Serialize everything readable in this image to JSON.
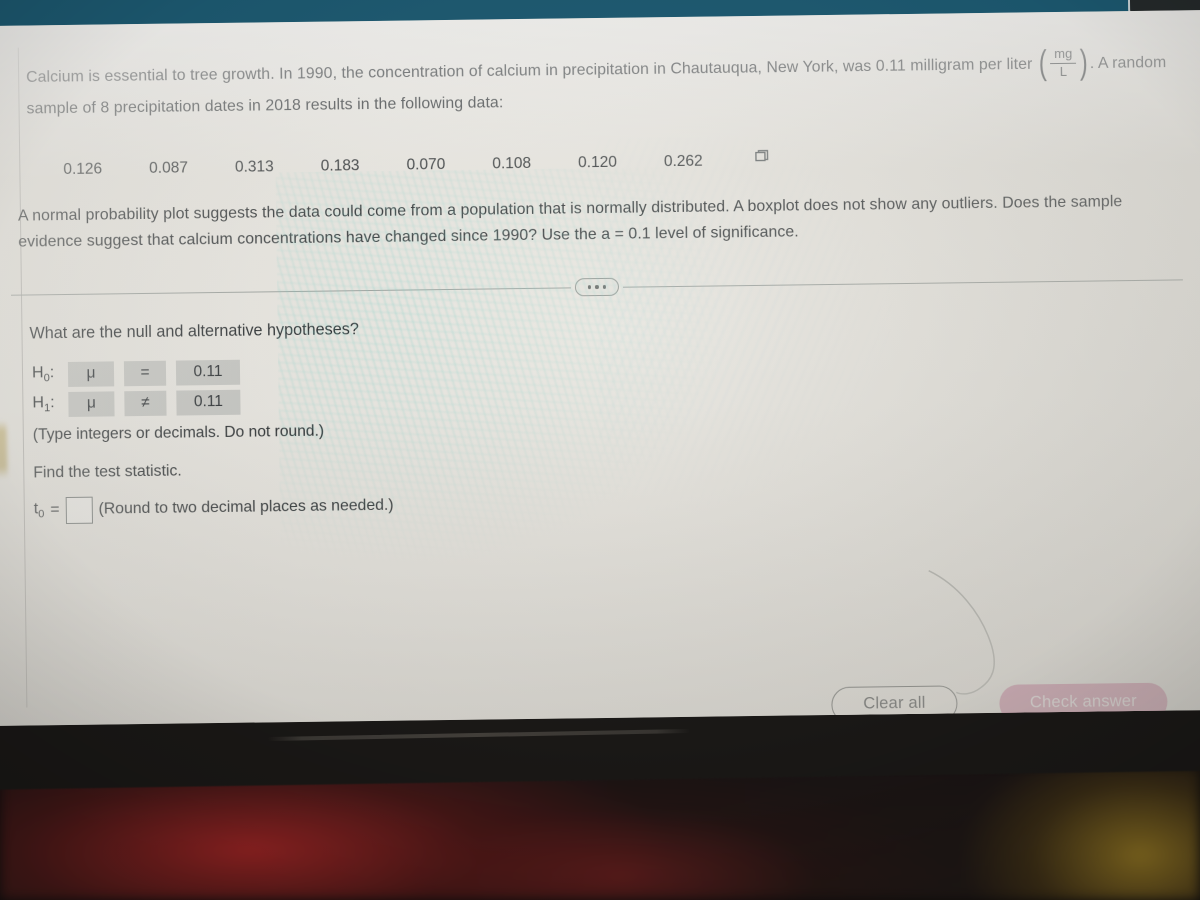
{
  "window": {
    "chrome_color": "#1d5b73",
    "page_background": "#eceae4"
  },
  "exercise": {
    "intro_part1": "Calcium is essential to tree growth. In 1990, the concentration of calcium in precipitation in Chautauqua, New York, was 0.11 milligram per liter",
    "unit_numerator": "mg",
    "unit_denominator": "L",
    "intro_part2": ". A random sample of 8 precipitation dates in 2018 results in the following data:",
    "data_values": [
      "0.126",
      "0.087",
      "0.313",
      "0.183",
      "0.070",
      "0.108",
      "0.120",
      "0.262"
    ],
    "copy_icon": "copy-to-spreadsheet-icon",
    "normal_plot_text": "A normal probability plot suggests the data could come from a population that is normally distributed. A boxplot does not show any outliers. Does the sample evidence suggest that calcium concentrations have changed since 1990? Use the a = 0.1 level of significance.",
    "expander_icon": "ellipsis-expander-icon"
  },
  "question": {
    "prompt": "What are the null and alternative hypotheses?",
    "hypotheses": [
      {
        "label": "H",
        "sub": "0",
        "parameter": "μ",
        "operator": "=",
        "value": "0.11"
      },
      {
        "label": "H",
        "sub": "1",
        "parameter": "μ",
        "operator": "≠",
        "value": "0.11"
      }
    ],
    "hint": "(Type integers or decimals. Do not round.)",
    "find_statistic": "Find the test statistic.",
    "t_label": "t",
    "t_sub": "0",
    "t_equals": "=",
    "t_value": "",
    "t_hint": "(Round to two decimal places as needed.)"
  },
  "actions": {
    "clear_all_label": "Clear all",
    "check_answer_label": "Check answer",
    "check_answer_color": "#cf87a3"
  }
}
